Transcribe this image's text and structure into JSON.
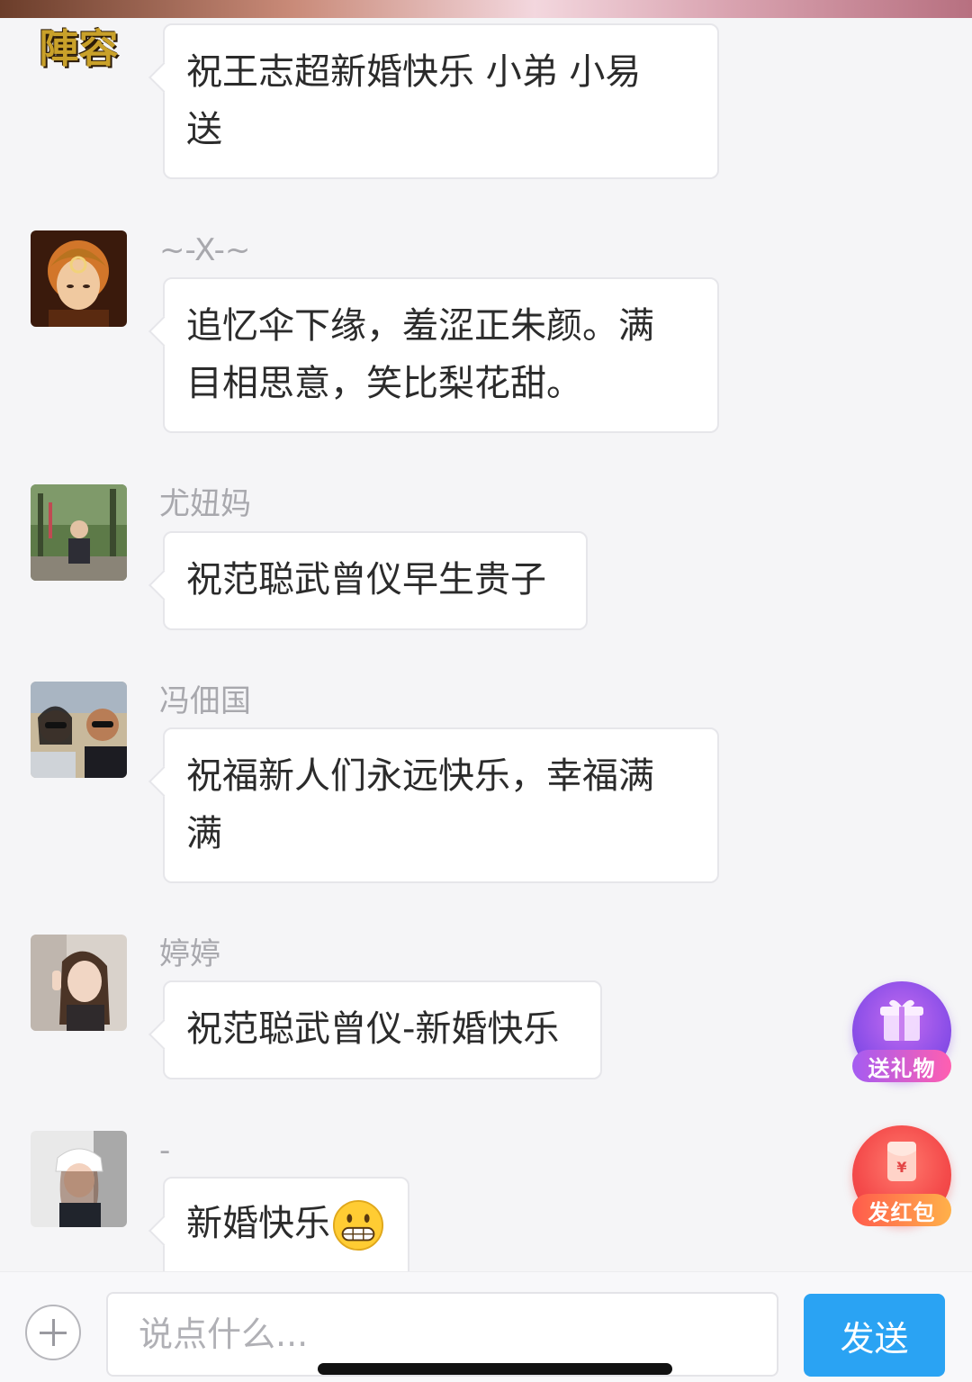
{
  "top_logo_text": "陣容",
  "messages": [
    {
      "sender": "",
      "text_lines": [
        "祝王志超新婚快乐 小弟 小易",
        "送"
      ]
    },
    {
      "sender": "~-X-~",
      "text_lines": [
        "追忆伞下缘，羞涩正朱颜。满",
        "目相思意，笑比梨花甜。"
      ]
    },
    {
      "sender": "尤妞妈",
      "text_lines": [
        "祝范聪武曾仪早生贵子"
      ]
    },
    {
      "sender": "冯佃国",
      "text_lines": [
        "祝福新人们永远快乐，幸福满",
        "满"
      ]
    },
    {
      "sender": "婷婷",
      "text_lines": [
        "祝范聪武曾仪-新婚快乐"
      ]
    },
    {
      "sender": "-",
      "text_lines": [
        "新婚快乐"
      ],
      "emoji": "grinning-face"
    }
  ],
  "fabs": {
    "gift_label": "送礼物",
    "redpacket_label": "发红包",
    "redpacket_symbol": "¥"
  },
  "input": {
    "placeholder": "说点什么...",
    "send_label": "发送"
  },
  "colors": {
    "send_button": "#2aa3f3",
    "gift_fab": "#8c4fe8",
    "redpacket_fab": "#f44a4a"
  }
}
